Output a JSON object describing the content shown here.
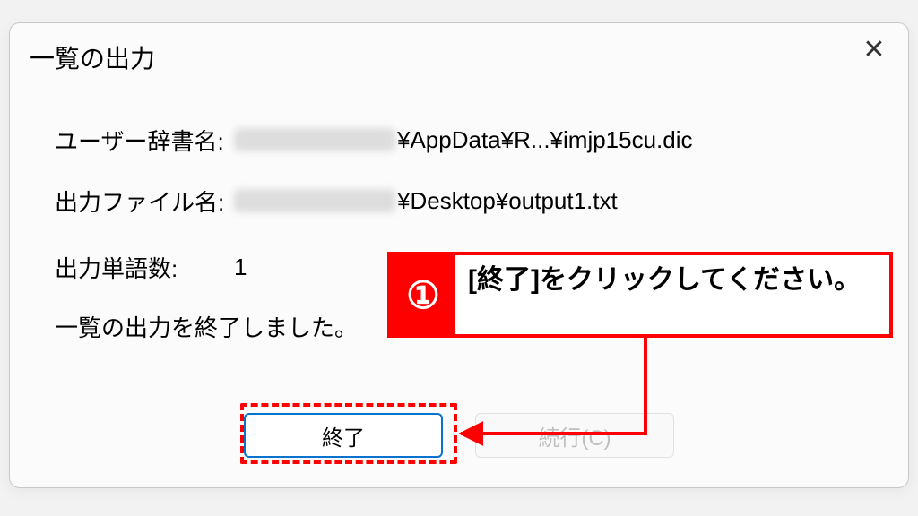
{
  "dialog": {
    "title": "一覧の出力",
    "fields": {
      "user_dict_label": "ユーザー辞書名:",
      "user_dict_value_visible": "¥AppData¥R...¥imjp15cu.dic",
      "output_file_label": "出力ファイル名:",
      "output_file_value_visible": "¥Desktop¥output1.txt",
      "word_count_label": "出力単語数:",
      "word_count_value": "1",
      "status_message": "一覧の出力を終了しました。"
    },
    "buttons": {
      "finish": "終了",
      "continue": "続行(C)"
    }
  },
  "annotation": {
    "step_number": "①",
    "step_text": "[終了]をクリックしてください。"
  }
}
